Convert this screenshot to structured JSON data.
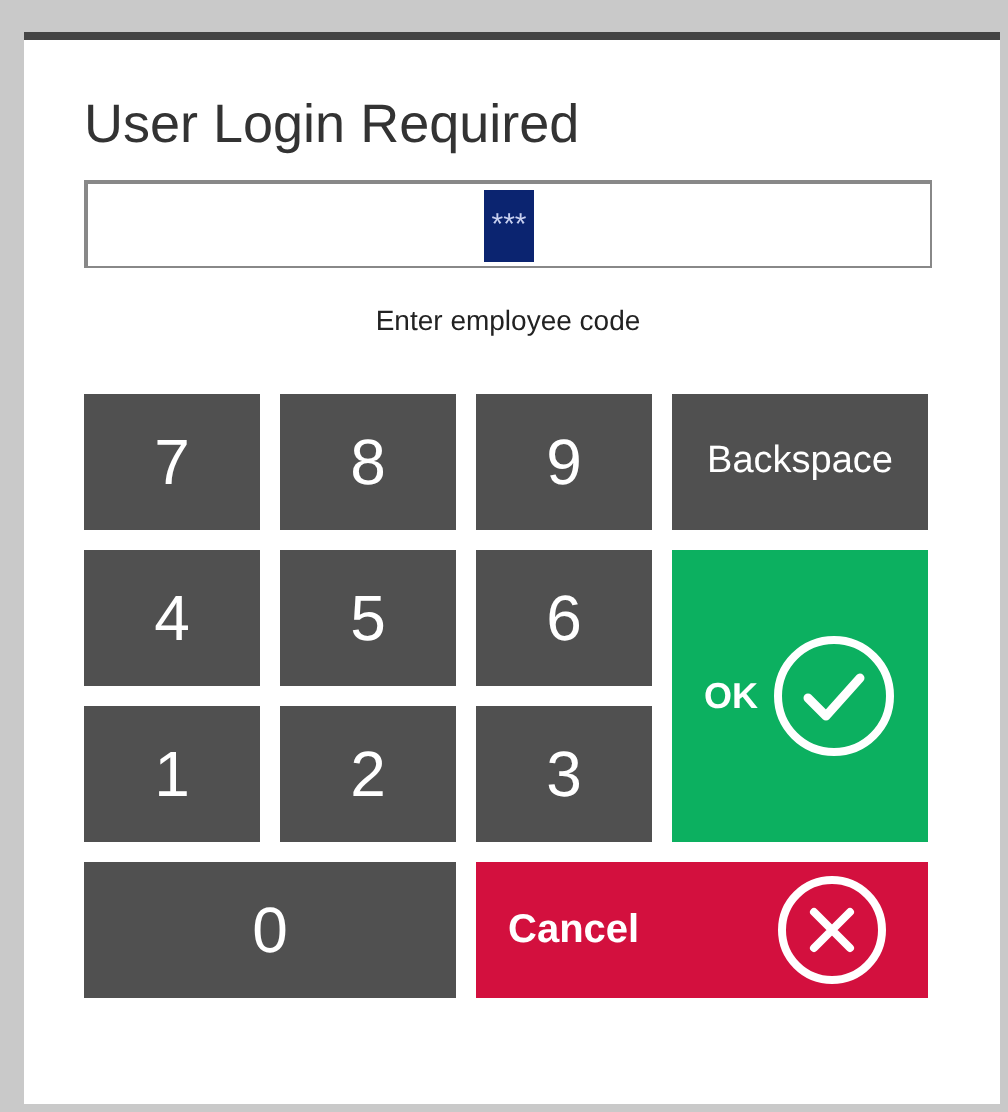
{
  "dialog": {
    "title": "User Login Required",
    "field": {
      "value": "***",
      "highlighted": true
    },
    "hint": "Enter employee code"
  },
  "keys": [
    {
      "kind": "digit",
      "label": "7"
    },
    {
      "kind": "digit",
      "label": "8"
    },
    {
      "kind": "digit",
      "label": "9"
    },
    {
      "kind": "backspace",
      "label": "Backspace"
    },
    {
      "kind": "digit",
      "label": "4"
    },
    {
      "kind": "digit",
      "label": "5"
    },
    {
      "kind": "digit",
      "label": "6"
    },
    {
      "kind": "ok",
      "label": "OK"
    },
    {
      "kind": "digit",
      "label": "1"
    },
    {
      "kind": "digit",
      "label": "2"
    },
    {
      "kind": "digit",
      "label": "3"
    },
    {
      "kind": "zero",
      "label": "0"
    },
    {
      "kind": "cancel",
      "label": "Cancel"
    }
  ]
}
